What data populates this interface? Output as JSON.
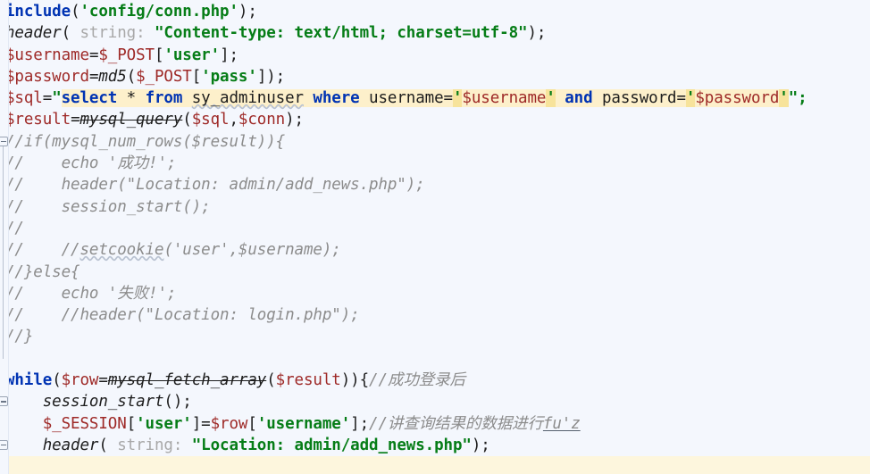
{
  "app": {
    "kind": "code-editor",
    "language": "PHP",
    "theme": "light",
    "colors": {
      "background": "#f4f7fd",
      "current_line": "#fdf6dd",
      "keyword": "#0033b3",
      "string": "#067d17",
      "variable": "#9e2927",
      "comment": "#8c8c8c",
      "inlay_hint": "#a8a8a8",
      "sql_highlight": "#fdf0cb",
      "sql_quote_highlight": "#f7e39b",
      "plain_text": "#1d1d1d",
      "gutter": "#f4f7fd"
    }
  },
  "editor": {
    "caret_line_index": 21,
    "caret_text": "fu'z",
    "inlay_hint_label": "string:",
    "fold_marker_lines": [
      6,
      18,
      20
    ],
    "lines": [
      {
        "id": "line-include",
        "text": "include('config/conn.php');",
        "tokens": [
          {
            "t": "include",
            "c": "kw"
          },
          {
            "t": "(",
            "c": "plain"
          },
          {
            "t": "'config/conn.php'",
            "c": "str"
          },
          {
            "t": ");",
            "c": "plain"
          }
        ]
      },
      {
        "id": "line-header-charset",
        "text": "header( string: \"Content-type: text/html; charset=utf-8\");",
        "tokens": [
          {
            "t": "header",
            "c": "fn"
          },
          {
            "t": "( ",
            "c": "plain"
          },
          {
            "t": "string:",
            "c": "hint"
          },
          {
            "t": " ",
            "c": "plain"
          },
          {
            "t": "\"Content-type: text/html; charset=utf-8\"",
            "c": "str"
          },
          {
            "t": ");",
            "c": "plain"
          }
        ]
      },
      {
        "id": "line-username",
        "text": "$username=$_POST['user'];",
        "tokens": [
          {
            "t": "$username",
            "c": "phpvar"
          },
          {
            "t": "=",
            "c": "plain"
          },
          {
            "t": "$_POST",
            "c": "phpvar"
          },
          {
            "t": "[",
            "c": "plain"
          },
          {
            "t": "'user'",
            "c": "str"
          },
          {
            "t": "];",
            "c": "plain"
          }
        ]
      },
      {
        "id": "line-password",
        "text": "$password=md5($_POST['pass']);",
        "tokens": [
          {
            "t": "$password",
            "c": "phpvar"
          },
          {
            "t": "=",
            "c": "plain"
          },
          {
            "t": "md5",
            "c": "fn"
          },
          {
            "t": "(",
            "c": "plain"
          },
          {
            "t": "$_POST",
            "c": "phpvar"
          },
          {
            "t": "[",
            "c": "plain"
          },
          {
            "t": "'pass'",
            "c": "str"
          },
          {
            "t": "]);",
            "c": "plain"
          }
        ]
      },
      {
        "id": "line-sql",
        "text": "$sql=\"select * from sy_adminuser where username='$username' and password='$password'\";",
        "tokens": [
          {
            "t": "$sql",
            "c": "phpvar"
          },
          {
            "t": "=",
            "c": "plain"
          },
          {
            "t": "\"",
            "c": "str"
          },
          {
            "t": "select",
            "c": "sqlkw"
          },
          {
            "t": " * ",
            "c": "sqlid"
          },
          {
            "t": "from",
            "c": "sqlkw"
          },
          {
            "t": " ",
            "c": "sqlid"
          },
          {
            "t": "sy_adminuser",
            "c": "sqlid squig"
          },
          {
            "t": " ",
            "c": "sqlid"
          },
          {
            "t": "where",
            "c": "sqlkw"
          },
          {
            "t": " username=",
            "c": "sqlid"
          },
          {
            "t": "'",
            "c": "sqlq"
          },
          {
            "t": "$username",
            "c": "sqlvar"
          },
          {
            "t": "'",
            "c": "sqlq"
          },
          {
            "t": " ",
            "c": "sqlid"
          },
          {
            "t": "and",
            "c": "sqlkw"
          },
          {
            "t": " password=",
            "c": "sqlid"
          },
          {
            "t": "'",
            "c": "sqlq"
          },
          {
            "t": "$password",
            "c": "sqlvar"
          },
          {
            "t": "'",
            "c": "sqlq"
          },
          {
            "t": "\";",
            "c": "str"
          }
        ]
      },
      {
        "id": "line-result",
        "text": "$result=mysql_query($sql,$conn);",
        "tokens": [
          {
            "t": "$result",
            "c": "phpvar"
          },
          {
            "t": "=",
            "c": "plain"
          },
          {
            "t": "mysql_query",
            "c": "fn dep"
          },
          {
            "t": "(",
            "c": "plain"
          },
          {
            "t": "$sql",
            "c": "phpvar"
          },
          {
            "t": ",",
            "c": "plain"
          },
          {
            "t": "$conn",
            "c": "phpvar"
          },
          {
            "t": ");",
            "c": "plain"
          }
        ]
      },
      {
        "id": "line-cmt-if",
        "text": "//if(mysql_num_rows($result)){",
        "tokens": [
          {
            "t": "//if(mysql_num_rows($result)){",
            "c": "cmt"
          }
        ]
      },
      {
        "id": "line-cmt-echo-success",
        "text": "//    echo '成功!';",
        "tokens": [
          {
            "t": "//    echo '",
            "c": "cmt"
          },
          {
            "t": "成功",
            "c": "cmt cn"
          },
          {
            "t": "!';",
            "c": "cmt"
          }
        ]
      },
      {
        "id": "line-cmt-header-addnews",
        "text": "//    header(\"Location: admin/add_news.php\");",
        "tokens": [
          {
            "t": "//    header(\"Location: admin/add_news.php\");",
            "c": "cmt"
          }
        ]
      },
      {
        "id": "line-cmt-session-start",
        "text": "//    session_start();",
        "tokens": [
          {
            "t": "//    session_start();",
            "c": "cmt"
          }
        ]
      },
      {
        "id": "line-cmt-blank-1",
        "text": "//",
        "tokens": [
          {
            "t": "//",
            "c": "cmt"
          }
        ]
      },
      {
        "id": "line-cmt-setcookie",
        "text": "//    //setcookie('user',$username);",
        "tokens": [
          {
            "t": "//    //",
            "c": "cmt"
          },
          {
            "t": "setcookie",
            "c": "cmt squig"
          },
          {
            "t": "('user',$username);",
            "c": "cmt"
          }
        ]
      },
      {
        "id": "line-cmt-else",
        "text": "//}else{",
        "tokens": [
          {
            "t": "//}else{",
            "c": "cmt"
          }
        ]
      },
      {
        "id": "line-cmt-echo-fail",
        "text": "//    echo '失败!';",
        "tokens": [
          {
            "t": "//    echo '",
            "c": "cmt"
          },
          {
            "t": "失败",
            "c": "cmt cn"
          },
          {
            "t": "!';",
            "c": "cmt"
          }
        ]
      },
      {
        "id": "line-cmt-header-login",
        "text": "//    //header(\"Location: login.php\");",
        "tokens": [
          {
            "t": "//    //header(\"Location: login.php\");",
            "c": "cmt"
          }
        ]
      },
      {
        "id": "line-cmt-close",
        "text": "//}",
        "tokens": [
          {
            "t": "//}",
            "c": "cmt"
          }
        ]
      },
      {
        "id": "line-blank-1",
        "text": "",
        "tokens": []
      },
      {
        "id": "line-while",
        "text": "while($row=mysql_fetch_array($result)){//成功登录后",
        "tokens": [
          {
            "t": "while",
            "c": "kw"
          },
          {
            "t": "(",
            "c": "plain"
          },
          {
            "t": "$row",
            "c": "phpvar"
          },
          {
            "t": "=",
            "c": "plain"
          },
          {
            "t": "mysql_fetch_array",
            "c": "fn dep"
          },
          {
            "t": "(",
            "c": "plain"
          },
          {
            "t": "$result",
            "c": "phpvar"
          },
          {
            "t": ")){",
            "c": "plain"
          },
          {
            "t": "//",
            "c": "cmt"
          },
          {
            "t": "成功登录后",
            "c": "cmt cn"
          }
        ]
      },
      {
        "id": "line-session-start",
        "text": "    session_start();",
        "tokens": [
          {
            "t": "    ",
            "c": "plain"
          },
          {
            "t": "session_start",
            "c": "fn"
          },
          {
            "t": "();",
            "c": "plain"
          }
        ]
      },
      {
        "id": "line-session-assign",
        "text": "    $_SESSION['user']=$row['username'];//讲查询结果的数据进行fu'z",
        "tokens": [
          {
            "t": "    ",
            "c": "plain"
          },
          {
            "t": "$_SESSION",
            "c": "phpvar"
          },
          {
            "t": "[",
            "c": "plain"
          },
          {
            "t": "'user'",
            "c": "str"
          },
          {
            "t": "]=",
            "c": "plain"
          },
          {
            "t": "$row",
            "c": "phpvar"
          },
          {
            "t": "[",
            "c": "plain"
          },
          {
            "t": "'username'",
            "c": "str"
          },
          {
            "t": "];",
            "c": "plain"
          },
          {
            "t": "//",
            "c": "cmt"
          },
          {
            "t": "讲查询结果的数据进行",
            "c": "cmt cn"
          },
          {
            "t": "fu'z",
            "c": "cmt ime"
          }
        ]
      },
      {
        "id": "line-header-location",
        "text": "    header( string: \"Location: admin/add_news.php\");",
        "tokens": [
          {
            "t": "    ",
            "c": "plain"
          },
          {
            "t": "header",
            "c": "fn"
          },
          {
            "t": "( ",
            "c": "plain"
          },
          {
            "t": "string:",
            "c": "hint"
          },
          {
            "t": " ",
            "c": "plain"
          },
          {
            "t": "\"Location: admin/add_news.php\"",
            "c": "str"
          },
          {
            "t": ");",
            "c": "plain"
          }
        ]
      }
    ]
  }
}
